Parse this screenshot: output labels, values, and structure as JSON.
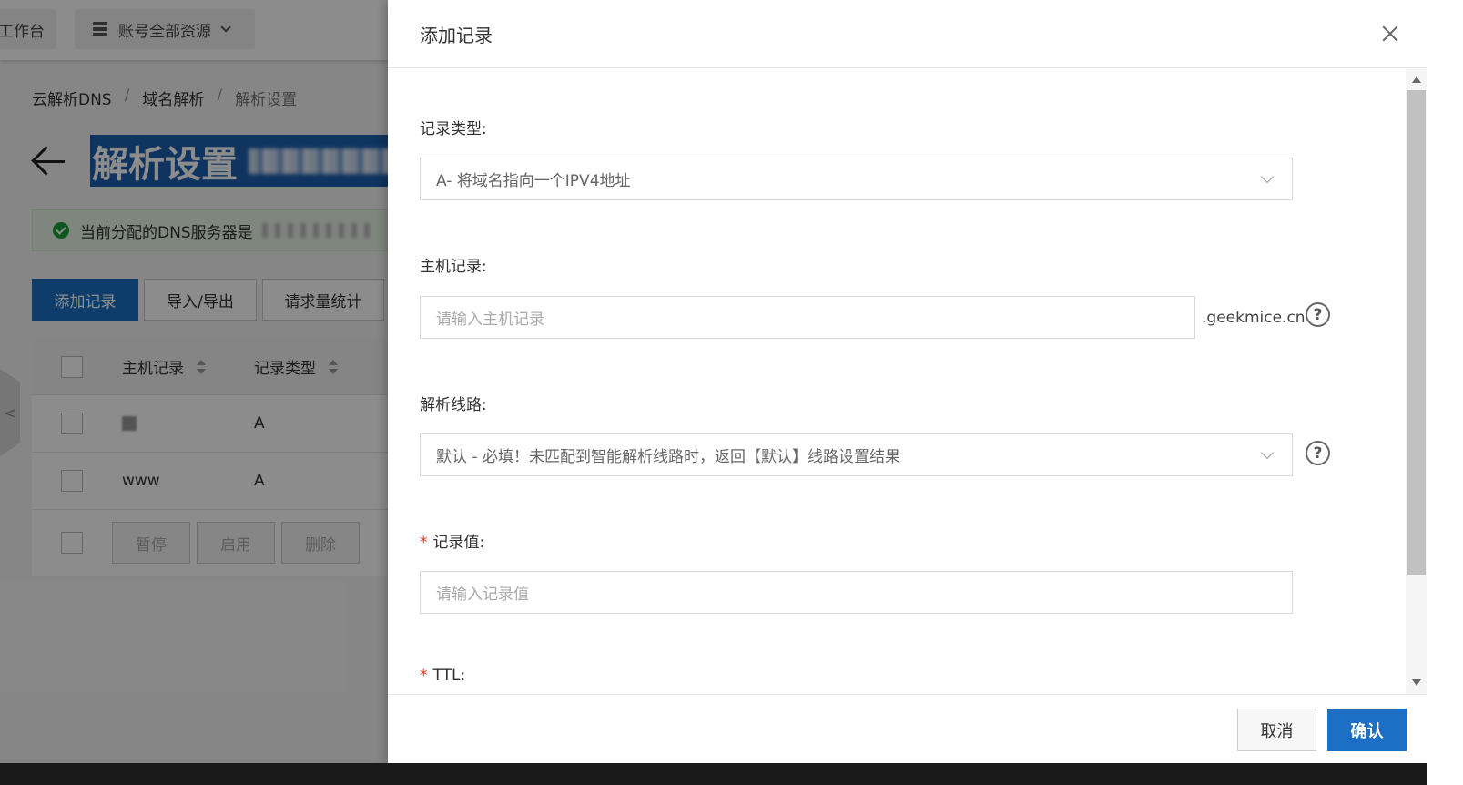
{
  "topbar": {
    "workbench_label": "工作台",
    "resources_label": "账号全部资源"
  },
  "breadcrumb": {
    "items": [
      "云解析DNS",
      "域名解析",
      "解析设置"
    ],
    "separator": "/"
  },
  "page": {
    "title": "解析设置",
    "notice": "当前分配的DNS服务器是"
  },
  "toolbar": {
    "add_record": "添加记录",
    "import_export": "导入/导出",
    "request_stats": "请求量统计"
  },
  "table": {
    "headers": {
      "host": "主机记录",
      "type": "记录类型"
    },
    "rows": [
      {
        "host": "",
        "type": "A"
      },
      {
        "host": "www",
        "type": "A"
      }
    ],
    "actions": {
      "pause": "暂停",
      "enable": "启用",
      "delete": "删除"
    }
  },
  "drawer": {
    "title": "添加记录",
    "fields": {
      "record_type": {
        "label": "记录类型:",
        "value": "A- 将域名指向一个IPV4地址"
      },
      "host_record": {
        "label": "主机记录:",
        "placeholder": "请输入主机记录",
        "suffix": ".geekmice.cn"
      },
      "line": {
        "label": "解析线路:",
        "value": "默认 - 必填！未匹配到智能解析线路时，返回【默认】线路设置结果"
      },
      "record_value": {
        "label": "记录值:",
        "placeholder": "请输入记录值",
        "required_mark": "*"
      },
      "ttl": {
        "label": "TTL:",
        "required_mark": "*"
      }
    },
    "footer": {
      "cancel": "取消",
      "confirm": "确认"
    }
  },
  "colors": {
    "primary": "#1c6fc4",
    "required": "#e0301e",
    "success": "#1e9e3a",
    "overlay": "rgba(0,0,0,0.45)"
  },
  "icons": {
    "close": "close-icon",
    "help": "question-circle-icon",
    "back": "arrow-left-icon",
    "select": "chevron-down-icon"
  }
}
